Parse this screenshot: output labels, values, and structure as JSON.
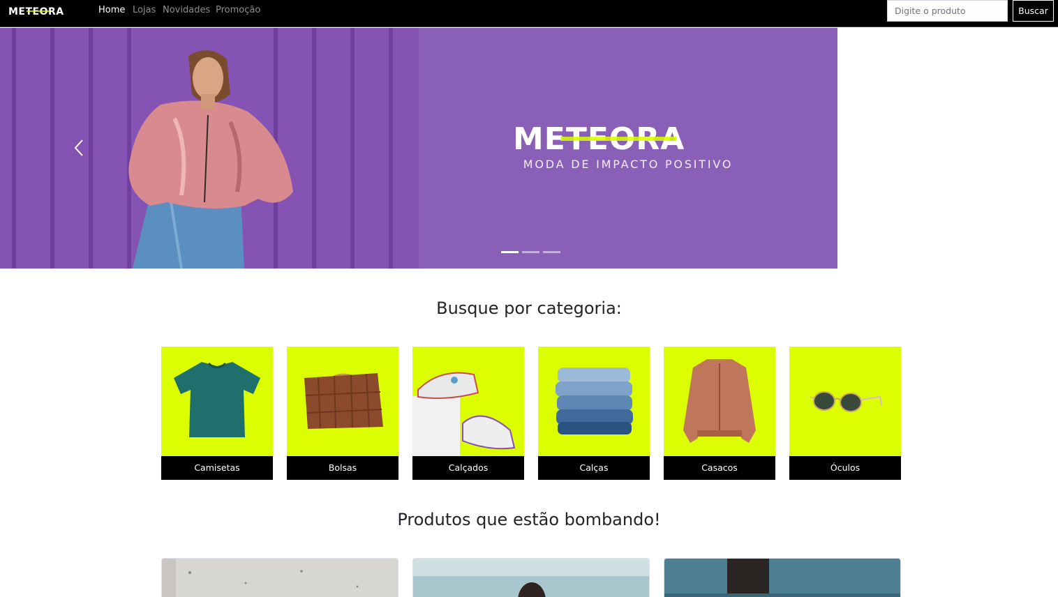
{
  "nav": {
    "brand": "METEORA",
    "links": [
      "Home",
      "Lojas",
      "Novidades",
      "Promoção"
    ],
    "search_placeholder": "Digite o produto",
    "search_button": "Buscar"
  },
  "hero": {
    "brand": "METEORA",
    "tagline": "MODA DE IMPACTO POSITIVO",
    "slide_count": 3,
    "active_slide": 1
  },
  "categories": {
    "title": "Busque por categoria:",
    "items": [
      "Camisetas",
      "Bolsas",
      "Calçados",
      "Calças",
      "Casacos",
      "Óculos"
    ]
  },
  "trending": {
    "title": "Produtos que estão bombando!"
  },
  "colors": {
    "navbar": "#000000",
    "hero_purple": "#8a5fb8",
    "category_accent": "#dbff00",
    "label_bg": "#000000"
  }
}
